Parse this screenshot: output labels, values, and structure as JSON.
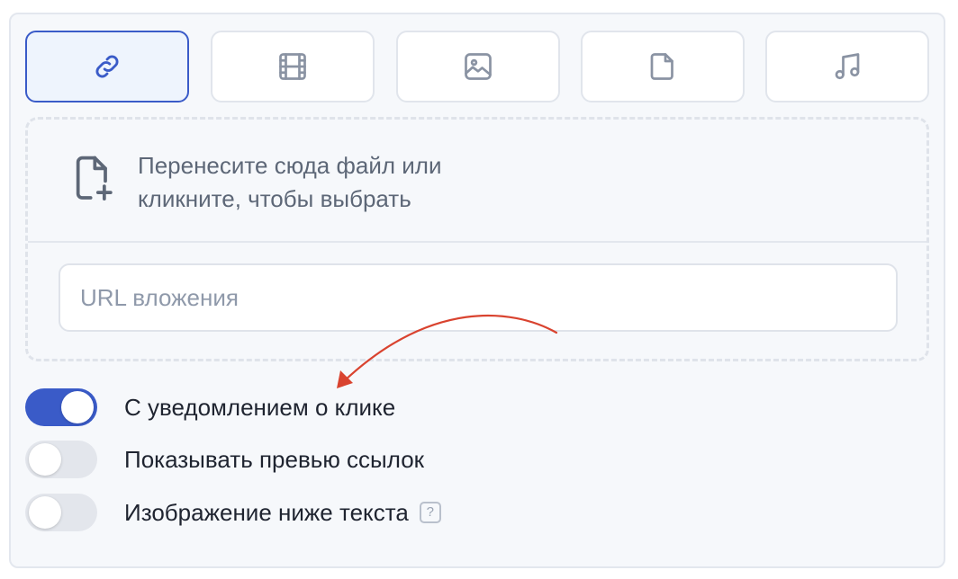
{
  "tabs": [
    {
      "icon": "link-icon",
      "active": true
    },
    {
      "icon": "film-icon",
      "active": false
    },
    {
      "icon": "image-icon",
      "active": false
    },
    {
      "icon": "document-icon",
      "active": false
    },
    {
      "icon": "music-icon",
      "active": false
    }
  ],
  "dropzone": {
    "icon": "file-plus-icon",
    "text_line1": "Перенесите сюда файл или",
    "text_line2": "кликните, чтобы выбрать"
  },
  "url_field": {
    "placeholder": "URL вложения",
    "value": ""
  },
  "annotation": {
    "icon": "red-arrow-icon",
    "color": "#d9432f"
  },
  "toggles": [
    {
      "label": "С уведомлением о клике",
      "on": true
    },
    {
      "label": "Показывать превью ссылок",
      "on": false
    },
    {
      "label": "Изображение ниже текста",
      "on": false,
      "help": "?"
    }
  ],
  "colors": {
    "accent": "#3a5bc8",
    "icon": "#8a93a3",
    "text": "#1f2430",
    "muted_text": "#5d6777",
    "toggle_off": "#e3e6ec"
  }
}
